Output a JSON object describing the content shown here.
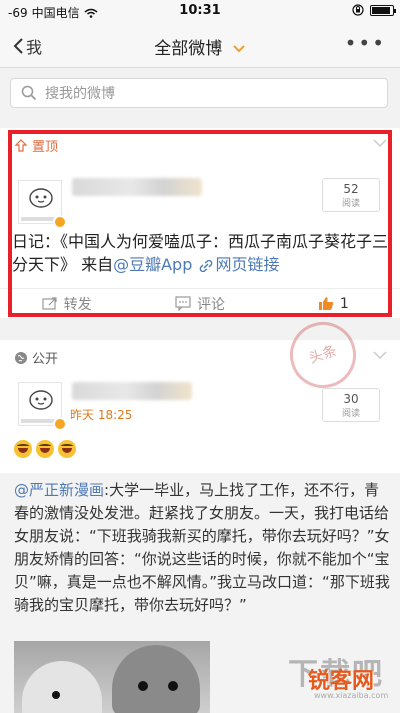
{
  "status_bar": {
    "signal": "-69",
    "carrier": "中国电信",
    "time": "10:31"
  },
  "nav": {
    "back_label": "我",
    "title": "全部微博",
    "more_label": "•••"
  },
  "search": {
    "placeholder": "搜我的微博"
  },
  "pinned_post": {
    "tag": "置顶",
    "read_count": "52",
    "read_label": "阅读",
    "text_prefix": "日记：《中国人为何爱嗑瓜子：西瓜子南瓜子葵花子三分天下》 来自",
    "source_link": "@豆瓣App",
    "web_link": "网页链接",
    "actions": {
      "share": "转发",
      "comment": "评论",
      "like": "1"
    }
  },
  "public_post": {
    "tag": "公开",
    "time": "昨天 18:25",
    "read_count": "30",
    "read_label": "阅读",
    "repost": {
      "mention": "@严正新漫画",
      "text": ":大学一毕业，马上找了工作，还不行，青春的激情没处发泄。赶紧找了女朋友。一天，我打电话给女朋友说：“下班我骑我新买的摩托，带你去玩好吗？”女朋友矫情的回答：“你说这些话的时候，你就不能加个“宝贝”嘛，真是一点也不解风情。”我立马改口道：“那下班我骑我的宝贝摩托，带你去玩好吗？”"
    }
  },
  "watermarks": {
    "stamp": "头条",
    "site_big": "下载吧",
    "site_brand": "锐客网",
    "site_url": "www.xiazaiba.com"
  },
  "colors": {
    "highlight_frame": "#e8202a",
    "link": "#4d7ab5",
    "accent_orange": "#e07b1e"
  }
}
